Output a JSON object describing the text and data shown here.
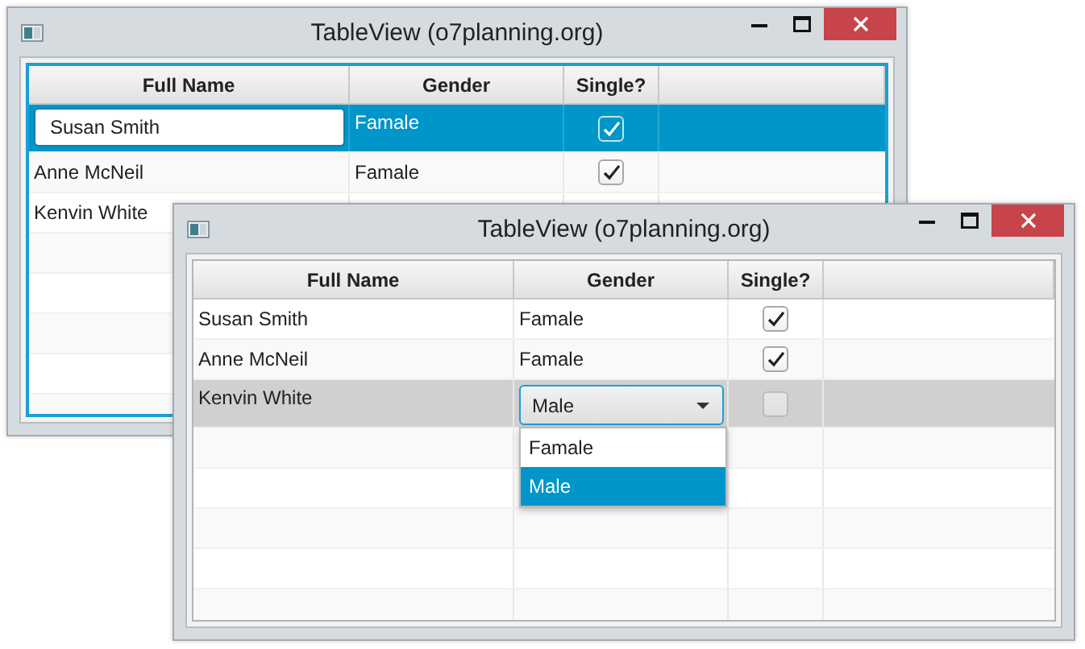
{
  "windows": [
    {
      "title": "TableView (o7planning.org)",
      "table": {
        "focused": true,
        "columns": [
          "Full Name",
          "Gender",
          "Single?"
        ],
        "rows": [
          {
            "full_name": "Susan Smith",
            "gender": "Famale",
            "single": true,
            "selected": true,
            "editing_name": true,
            "editing_gender": false
          },
          {
            "full_name": "Anne McNeil",
            "gender": "Famale",
            "single": true,
            "selected": false,
            "editing_name": false,
            "editing_gender": false
          },
          {
            "full_name": "Kenvin White",
            "selected": false,
            "editing_name": false,
            "editing_gender": false
          }
        ]
      }
    },
    {
      "title": "TableView (o7planning.org)",
      "table": {
        "focused": false,
        "columns": [
          "Full Name",
          "Gender",
          "Single?"
        ],
        "rows": [
          {
            "full_name": "Susan Smith",
            "gender": "Famale",
            "single": true,
            "selected": false,
            "editing_name": false,
            "editing_gender": false
          },
          {
            "full_name": "Anne McNeil",
            "gender": "Famale",
            "single": true,
            "selected": false,
            "editing_name": false,
            "editing_gender": false
          },
          {
            "full_name": "Kenvin White",
            "gender": "Male",
            "single": false,
            "selected": true,
            "editing_name": false,
            "editing_gender": true,
            "dropdown": [
              {
                "label": "Famale",
                "selected": false
              },
              {
                "label": "Male",
                "selected": true
              }
            ]
          }
        ]
      }
    }
  ]
}
